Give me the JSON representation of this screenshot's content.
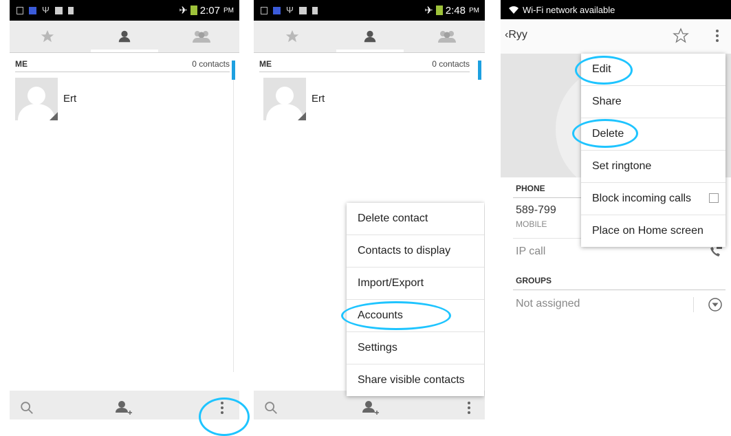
{
  "panel1": {
    "status_time": "2:07",
    "status_ampm": "PM",
    "section_label": "ME",
    "contacts_count": "0 contacts",
    "contact_name": "Ert"
  },
  "panel2": {
    "status_time": "2:48",
    "status_ampm": "PM",
    "section_label": "ME",
    "contacts_count": "0 contacts",
    "contact_name": "Ert",
    "menu_items": [
      "Delete contact",
      "Contacts to display",
      "Import/Export",
      "Accounts",
      "Settings",
      "Share visible contacts"
    ]
  },
  "panel3": {
    "status_text": "Wi-Fi network available",
    "back_label": "Ryy",
    "phone_section": "PHONE",
    "phone_number": "589-799",
    "phone_type": "MOBILE",
    "ip_call": "IP call",
    "groups_section": "GROUPS",
    "groups_value": "Not assigned",
    "menu_items": [
      "Edit",
      "Share",
      "Delete",
      "Set ringtone",
      "Block incoming calls",
      "Place on Home screen"
    ]
  },
  "colors": {
    "accent_scroll": "#1da0e0",
    "highlight_ellipse": "#1ec4ff",
    "icon_gray": "#8a8a8a"
  },
  "icons": [
    "star-icon",
    "contact-person-icon",
    "group-icon",
    "search-icon",
    "add-contact-icon",
    "overflow-menu-icon",
    "airplane-icon",
    "battery-icon",
    "wifi-icon",
    "back-chevron-icon",
    "star-outline-icon",
    "phone-ip-icon",
    "dropdown-circle-icon"
  ]
}
